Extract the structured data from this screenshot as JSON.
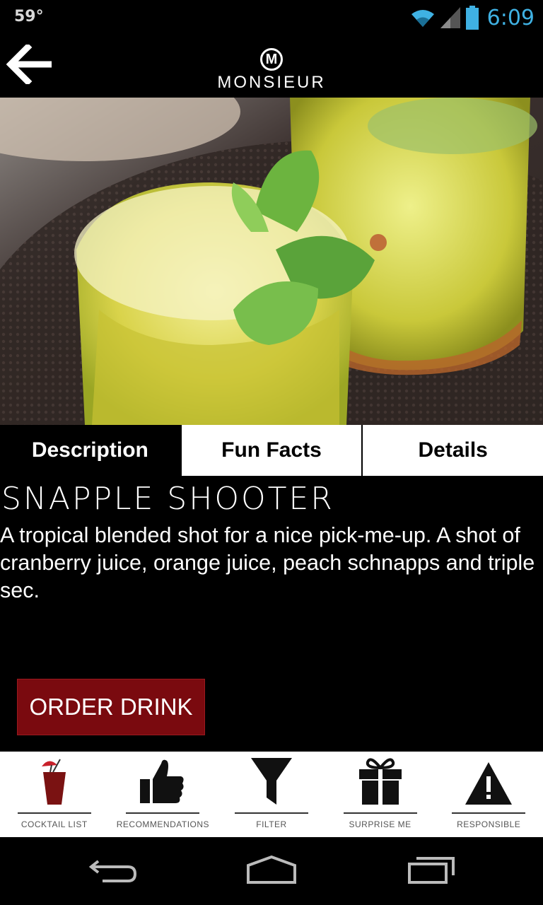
{
  "status_bar": {
    "temperature": "59°",
    "time": "6:09"
  },
  "header": {
    "brand_mark": "M",
    "brand_name": "MONSIEUR"
  },
  "tabs": [
    {
      "label": "Description",
      "active": true
    },
    {
      "label": "Fun Facts",
      "active": false
    },
    {
      "label": "Details",
      "active": false
    }
  ],
  "drink": {
    "title": "SNAPPLE SHOOTER",
    "description": "A tropical blended shot for a nice pick-me-up. A shot of cranberry juice, orange juice, peach schnapps and triple sec."
  },
  "order_button": {
    "label": "ORDER DRINK",
    "color": "#7a0a0f"
  },
  "bottom_nav": [
    {
      "label": "COCKTAIL LIST",
      "icon": "cocktail-glass-icon"
    },
    {
      "label": "RECOMMENDATIONS",
      "icon": "thumbs-up-icon"
    },
    {
      "label": "FILTER",
      "icon": "funnel-icon"
    },
    {
      "label": "SURPRISE ME",
      "icon": "gift-icon"
    },
    {
      "label": "RESPONSIBLE",
      "icon": "warning-icon"
    }
  ],
  "colors": {
    "clock": "#3fb1e3",
    "accent": "#7a0a0f"
  }
}
